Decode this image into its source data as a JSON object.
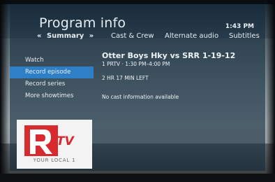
{
  "header": {
    "title": "Program info",
    "clock": "1:43 PM"
  },
  "tabs": {
    "left_arrow": "«",
    "right_arrow": "»",
    "items": [
      {
        "label": "Summary",
        "selected": true
      },
      {
        "label": "Cast & Crew"
      },
      {
        "label": "Alternate audio"
      },
      {
        "label": "Subtitles"
      }
    ]
  },
  "menu": {
    "items": [
      {
        "label": "Watch"
      },
      {
        "label": "Record episode",
        "selected": true
      },
      {
        "label": "Record series"
      },
      {
        "label": "More showtimes"
      }
    ]
  },
  "program": {
    "title": "Otter Boys Hky vs SRR 1-19-12",
    "channel_line": "1 PRTV · 1:30 PM–4:00 PM",
    "time_left": "2 HR 17 MIN LEFT",
    "cast_info": "No cast information available"
  },
  "logo": {
    "letters": "R TV",
    "tagline": "YOUR LOCAL 1"
  },
  "colors": {
    "accent": "#2f7fc6",
    "overlay": "#12283a",
    "logo_red": "#d8292f"
  }
}
